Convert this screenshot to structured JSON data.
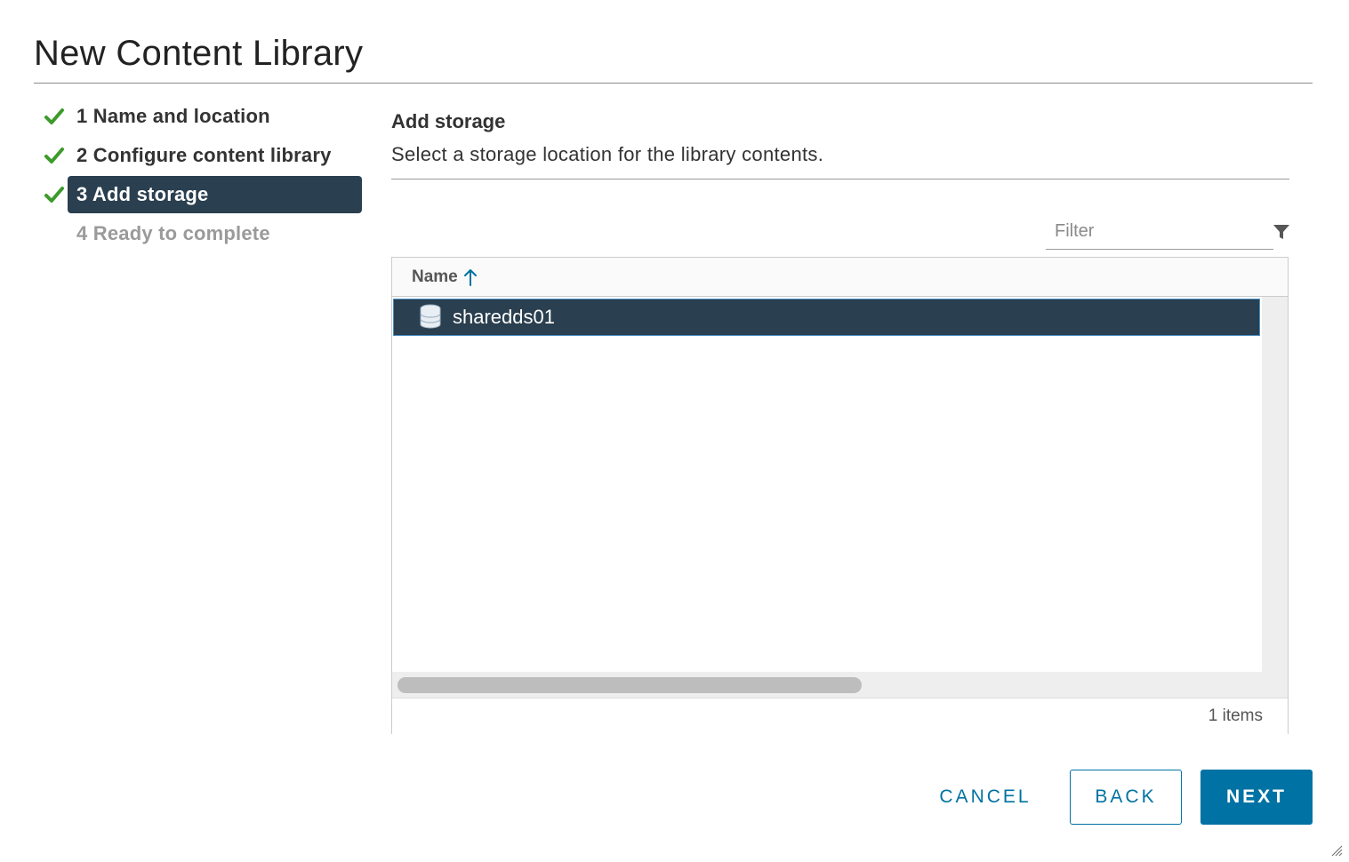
{
  "dialog": {
    "title": "New Content Library"
  },
  "steps": [
    {
      "label": "1 Name and location",
      "state": "done"
    },
    {
      "label": "2 Configure content library",
      "state": "done"
    },
    {
      "label": "3 Add storage",
      "state": "active"
    },
    {
      "label": "4 Ready to complete",
      "state": "pending"
    }
  ],
  "content": {
    "title": "Add storage",
    "description": "Select a storage location for the library contents."
  },
  "filter": {
    "placeholder": "Filter",
    "value": ""
  },
  "grid": {
    "columns": [
      "Name"
    ],
    "sort": "ascending",
    "rows": [
      {
        "name": "sharedds01",
        "icon": "datastore-icon",
        "selected": true
      }
    ],
    "footer": "1 items"
  },
  "buttons": {
    "cancel": "CANCEL",
    "back": "BACK",
    "next": "NEXT"
  },
  "colors": {
    "accent": "#0072a3",
    "selected_bg": "#2a3f4f",
    "check": "#3c9b2a"
  }
}
